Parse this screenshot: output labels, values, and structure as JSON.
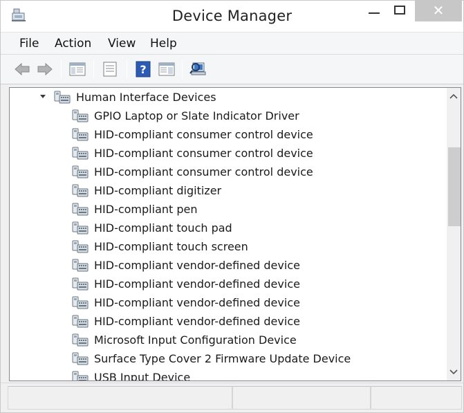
{
  "window": {
    "title": "Device Manager",
    "icon": "device-manager-icon",
    "controls": {
      "minimize": "minimize-icon",
      "maximize": "maximize-icon",
      "close": "✕"
    }
  },
  "menu": {
    "items": [
      {
        "label": "File"
      },
      {
        "label": "Action"
      },
      {
        "label": "View"
      },
      {
        "label": "Help"
      }
    ]
  },
  "toolbar": {
    "buttons": [
      {
        "name": "back-arrow-icon"
      },
      {
        "name": "forward-arrow-icon"
      },
      {
        "name": "show-hide-console-tree-icon"
      },
      {
        "name": "properties-icon"
      },
      {
        "name": "help-icon"
      },
      {
        "name": "action-pane-icon"
      },
      {
        "name": "scan-hardware-changes-icon"
      }
    ]
  },
  "tree": {
    "category": {
      "label": "Human Interface Devices",
      "expanded": true,
      "icon": "hid-category-icon"
    },
    "devices": [
      {
        "label": "GPIO Laptop or Slate Indicator Driver"
      },
      {
        "label": "HID-compliant consumer control device"
      },
      {
        "label": "HID-compliant consumer control device"
      },
      {
        "label": "HID-compliant consumer control device"
      },
      {
        "label": "HID-compliant digitizer"
      },
      {
        "label": "HID-compliant pen"
      },
      {
        "label": "HID-compliant touch pad"
      },
      {
        "label": "HID-compliant touch screen"
      },
      {
        "label": "HID-compliant vendor-defined device"
      },
      {
        "label": "HID-compliant vendor-defined device"
      },
      {
        "label": "HID-compliant vendor-defined device"
      },
      {
        "label": "HID-compliant vendor-defined device"
      },
      {
        "label": "Microsoft Input Configuration Device"
      },
      {
        "label": "Surface Type Cover 2 Firmware Update Device"
      },
      {
        "label": "USB Input Device"
      }
    ]
  },
  "statusbar": {
    "cells": [
      "",
      "",
      ""
    ]
  },
  "colors": {
    "close_button_bg": "#c7c7c7",
    "tree_background": "#ffffff",
    "chrome_background": "#f0f0f0"
  }
}
